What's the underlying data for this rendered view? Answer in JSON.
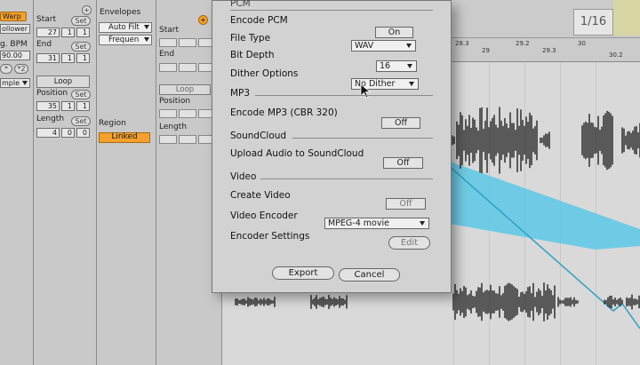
{
  "clip": {
    "warp_label": "Warp",
    "follower_label": "ollower",
    "bpm_label": "g. BPM",
    "bpm_value": "90.00",
    "half_label": "*",
    "double_label": "*2",
    "warp_mode": "mple",
    "start_label": "Start",
    "set_label": "Set",
    "start_values": [
      "27",
      "1",
      "1"
    ],
    "end_label": "End",
    "end_values": [
      "31",
      "1",
      "1"
    ],
    "loop_label": "Loop",
    "position_label": "Position",
    "position_values": [
      "35",
      "1",
      "1"
    ],
    "length_label": "Length",
    "length_values": [
      "4",
      "0",
      "0"
    ]
  },
  "envelopes": {
    "title": "Envelopes",
    "device": "Auto Filt",
    "parameter": "Frequen",
    "region_label": "Region",
    "linked_label": "Linked",
    "start_label": "Start",
    "end_label": "End",
    "loop_label": "Loop",
    "position_label": "Position",
    "length_label": "Length"
  },
  "ruler": {
    "ticks": [
      "28.3",
      "29",
      "29.2",
      "29.3",
      "30",
      "30.2"
    ],
    "quantize": "1/16"
  },
  "dialog": {
    "pcm_header": "PCM",
    "encode_pcm_label": "Encode PCM",
    "encode_pcm_value": "On",
    "file_type_label": "File Type",
    "file_type_value": "WAV",
    "bit_depth_label": "Bit Depth",
    "bit_depth_value": "16",
    "dither_label": "Dither Options",
    "dither_value": "No Dither",
    "mp3_header": "MP3",
    "encode_mp3_label": "Encode MP3 (CBR 320)",
    "encode_mp3_value": "Off",
    "soundcloud_header": "SoundCloud",
    "upload_label": "Upload Audio to SoundCloud",
    "upload_value": "Off",
    "video_header": "Video",
    "create_video_label": "Create Video",
    "create_video_value": "Off",
    "video_encoder_label": "Video Encoder",
    "video_encoder_value": "MPEG-4 movie",
    "encoder_settings_label": "Encoder Settings",
    "edit_label": "Edit",
    "export_label": "Export",
    "cancel_label": "Cancel"
  },
  "colors": {
    "accent_orange": "#f3a02e",
    "envelope_blue": "#5cc8e6",
    "waveform": "#141414"
  }
}
